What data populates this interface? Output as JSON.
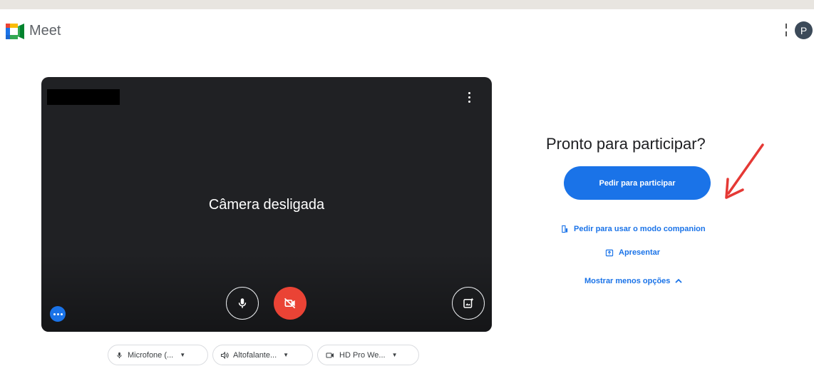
{
  "app": {
    "name": "Meet",
    "avatar_initial": "P"
  },
  "preview": {
    "camera_status": "Câmera desligada",
    "more_options_icon": "vertical-dots-icon",
    "mic_icon": "microphone-icon",
    "camera_icon": "video-off-icon",
    "effects_icon": "visual-effects-icon"
  },
  "devices": {
    "microphone": "Microfone (...",
    "speaker": "Altofalante...",
    "camera": "HD Pro We..."
  },
  "join": {
    "title": "Pronto para participar?",
    "join_button": "Pedir para participar",
    "companion_link": "Pedir para usar o modo companion",
    "present_link": "Apresentar",
    "options_link": "Mostrar menos opções"
  },
  "colors": {
    "accent": "#1a73e8",
    "camera_off_red": "#ea4335",
    "preview_bg": "#202124",
    "annotation_arrow": "#e53935"
  }
}
